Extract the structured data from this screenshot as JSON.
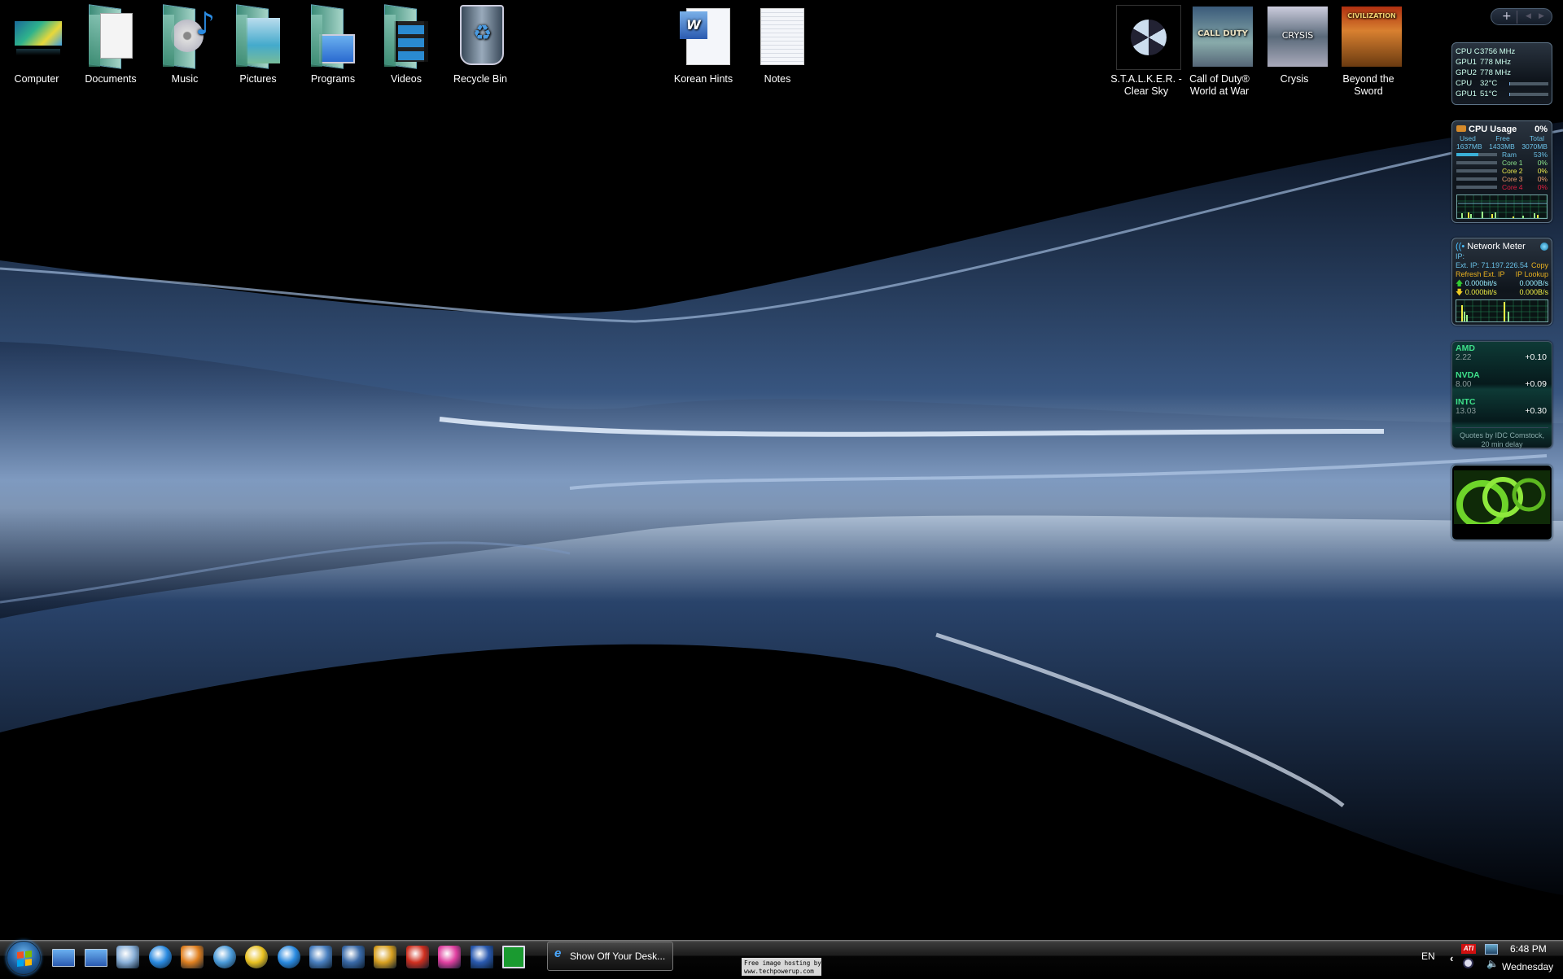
{
  "desktop": {
    "icons": [
      {
        "label": "Computer",
        "icon": "computer-icon"
      },
      {
        "label": "Documents",
        "icon": "documents-folder-icon"
      },
      {
        "label": "Music",
        "icon": "music-folder-icon"
      },
      {
        "label": "Pictures",
        "icon": "pictures-folder-icon"
      },
      {
        "label": "Programs",
        "icon": "programs-folder-icon"
      },
      {
        "label": "Videos",
        "icon": "videos-folder-icon"
      },
      {
        "label": "Recycle Bin",
        "icon": "recycle-bin-icon"
      },
      {
        "label": "Korean Hints",
        "icon": "word-document-icon"
      },
      {
        "label": "Notes",
        "icon": "text-document-icon"
      },
      {
        "label": "S.T.A.L.K.E.R. - Clear Sky",
        "icon": "stalker-game-icon"
      },
      {
        "label": "Call of Duty® World at War",
        "icon": "call-of-duty-game-icon"
      },
      {
        "label": "Crysis",
        "icon": "crysis-game-icon"
      },
      {
        "label": "Beyond the Sword",
        "icon": "civilization-game-icon"
      }
    ]
  },
  "sidebar_controls": {
    "add": "+",
    "prev": "◀",
    "next": "▶"
  },
  "gadgets": {
    "hw_monitor": {
      "rows": [
        {
          "label": "CPU C",
          "value": "3756 MHz"
        },
        {
          "label": "GPU1",
          "value": "778 MHz"
        },
        {
          "label": "GPU2",
          "value": "778 MHz"
        },
        {
          "label": "CPU",
          "value": "32°C",
          "level": 0.03
        },
        {
          "label": "GPU1",
          "value": "51°C",
          "level": 0.03
        }
      ]
    },
    "cpu_usage": {
      "title": "CPU Usage",
      "total": "0%",
      "used_label": "Used",
      "free_label": "Free",
      "total_label": "Total",
      "used": "1637MB",
      "free": "1433MB",
      "total_mem": "3070MB",
      "ram_label": "Ram",
      "ram": "53%",
      "ram_level": 0.53,
      "cores": [
        {
          "label": "Core 1",
          "value": "0%",
          "color": "#8ee88e"
        },
        {
          "label": "Core 2",
          "value": "0%",
          "color": "#f0f050"
        },
        {
          "label": "Core 3",
          "value": "0%",
          "color": "#f0a070"
        },
        {
          "label": "Core 4",
          "value": "0%",
          "color": "#e02040"
        }
      ]
    },
    "network": {
      "title": "Network Meter",
      "ip_label": "IP:",
      "ext_ip": "Ext. IP: 71.197.226.54",
      "copy": "Copy",
      "refresh": "Refresh Ext. IP",
      "lookup": "IP Lookup",
      "up_bits": "0.000bit/s",
      "up_bytes": "0.000B/s",
      "down_bits": "0.000bit/s",
      "down_bytes": "0.000B/s"
    },
    "stocks": {
      "quotes": [
        {
          "symbol": "AMD",
          "price": "2.22",
          "change": "+0.10"
        },
        {
          "symbol": "NVDA",
          "price": "8.00",
          "change": "+0.09"
        },
        {
          "symbol": "INTC",
          "price": "13.03",
          "change": "+0.30"
        }
      ],
      "footer": "Quotes by IDC Comstock, 20 min delay"
    }
  },
  "taskbar": {
    "quick_launch": [
      "show-desktop-icon",
      "switch-windows-icon",
      "control-panel-icon",
      "internet-explorer-icon",
      "windows-media-player-icon",
      "itunes-icon",
      "media-player-icon",
      "update-icon",
      "hp-icon",
      "photo-app-icon",
      "globe-app-icon",
      "ccleaner-icon",
      "paint-app-icon",
      "word-icon",
      "utorrent-icon"
    ],
    "task_button": "Show Off Your Desk...",
    "language": "EN",
    "clock_time": "6:48 PM",
    "clock_day": "Wednesday",
    "ati_label": "ATI"
  },
  "watermark": {
    "line1": "Free image hosting by",
    "line2": "www.techpowerup.com"
  }
}
